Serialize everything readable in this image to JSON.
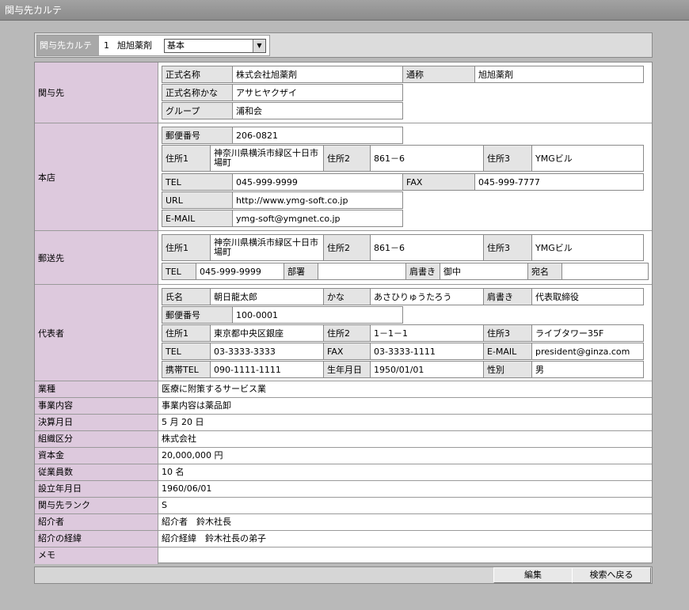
{
  "window": {
    "title": "関与先カルテ"
  },
  "selector": {
    "label": "関与先カルテ",
    "number": "1",
    "name": "旭旭薬剤",
    "dropdown_value": "基本"
  },
  "sections": {
    "kanyo": {
      "heading": "関与先",
      "official_name_label": "正式名称",
      "official_name": "株式会社旭薬剤",
      "common_name_label": "通称",
      "common_name": "旭旭薬剤",
      "kana_label": "正式名称かな",
      "kana": "アサヒヤクザイ",
      "group_label": "グループ",
      "group": "浦和会"
    },
    "honten": {
      "heading": "本店",
      "zip_label": "郵便番号",
      "zip": "206-0821",
      "addr1_label": "住所1",
      "addr1": "神奈川県横浜市緑区十日市場町",
      "addr2_label": "住所2",
      "addr2": "861－6",
      "addr3_label": "住所3",
      "addr3": "YMGビル",
      "tel_label": "TEL",
      "tel": "045-999-9999",
      "fax_label": "FAX",
      "fax": "045-999-7777",
      "url_label": "URL",
      "url": "http://www.ymg-soft.co.jp",
      "email_label": "E-MAIL",
      "email": "ymg-soft@ymgnet.co.jp"
    },
    "yusou": {
      "heading": "郵送先",
      "addr1_label": "住所1",
      "addr1": "神奈川県横浜市緑区十日市場町",
      "addr2_label": "住所2",
      "addr2": "861－6",
      "addr3_label": "住所3",
      "addr3": "YMGビル",
      "tel_label": "TEL",
      "tel": "045-999-9999",
      "dept_label": "部署",
      "dept": "",
      "title_label": "肩書き",
      "title": "御中",
      "addressee_label": "宛名",
      "addressee": ""
    },
    "daihyo": {
      "heading": "代表者",
      "name_label": "氏名",
      "name": "朝日龍太郎",
      "kana_label": "かな",
      "kana": "あさひりゅうたろう",
      "title_label": "肩書き",
      "title": "代表取締役",
      "zip_label": "郵便番号",
      "zip": "100-0001",
      "addr1_label": "住所1",
      "addr1": "東京都中央区銀座",
      "addr2_label": "住所2",
      "addr2": "1－1－1",
      "addr3_label": "住所3",
      "addr3": "ライブタワー35F",
      "tel_label": "TEL",
      "tel": "03-3333-3333",
      "fax_label": "FAX",
      "fax": "03-3333-1111",
      "email_label": "E-MAIL",
      "email": "president@ginza.com",
      "mobile_label": "携帯TEL",
      "mobile": "090-1111-1111",
      "birth_label": "生年月日",
      "birth": "1950/01/01",
      "gender_label": "性別",
      "gender": "男"
    }
  },
  "simple_rows": [
    {
      "label": "業種",
      "value": "医療に附策するサービス業"
    },
    {
      "label": "事業内容",
      "value": "事業内容は薬品卸"
    },
    {
      "label": "決算月日",
      "value": "5 月 20 日"
    },
    {
      "label": "組織区分",
      "value": "株式会社"
    },
    {
      "label": "資本金",
      "value": "20,000,000 円"
    },
    {
      "label": "従業員数",
      "value": "10 名"
    },
    {
      "label": "設立年月日",
      "value": "1960/06/01"
    },
    {
      "label": "関与先ランク",
      "value": "S"
    },
    {
      "label": "紹介者",
      "value": "紹介者　鈴木社長"
    },
    {
      "label": "紹介の経緯",
      "value": "紹介経緯　鈴木社長の弟子"
    },
    {
      "label": "メモ",
      "value": ""
    }
  ],
  "buttons": {
    "edit": "編集",
    "back": "検索へ戻る"
  }
}
